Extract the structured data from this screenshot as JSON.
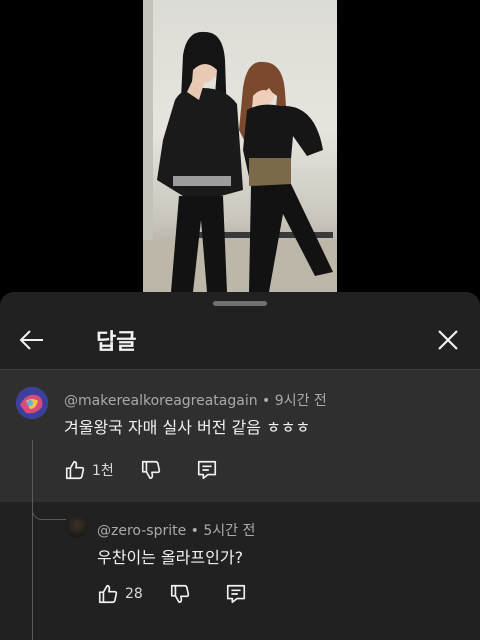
{
  "sheet": {
    "title": "답글"
  },
  "parent_comment": {
    "handle": "@makerealkoreagreatagain",
    "time": "9시간 전",
    "text": "겨울왕국 자매 실사 버전 같음 ㅎㅎㅎ",
    "like_count": "1천"
  },
  "reply": {
    "handle": "@zero-sprite",
    "time": "5시간 전",
    "text": "우찬이는 올라프인가?",
    "like_count": "28"
  },
  "separator": " • ",
  "icons": [
    "back-arrow-icon",
    "close-icon",
    "thumbs-up-icon",
    "thumbs-down-icon",
    "reply-icon"
  ],
  "colors": {
    "sheet_bg": "#212121",
    "highlight_bg": "#2f2f2f",
    "text_primary": "#f1f1f1",
    "text_secondary": "#aaaaaa"
  }
}
